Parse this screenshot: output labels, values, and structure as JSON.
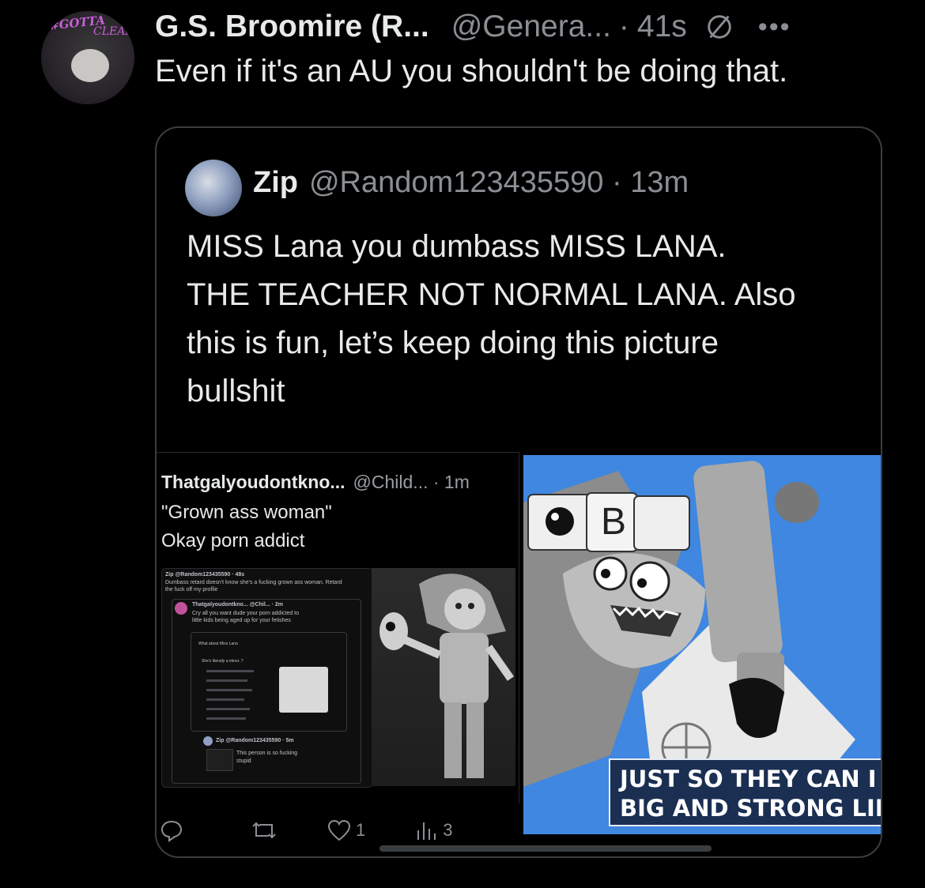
{
  "outer_tweet": {
    "avatar_tag": "#GOTTA",
    "avatar_tag2": "CLEAN",
    "author_name": "G.S. Broomire (R...",
    "handle": "@Genera...",
    "separator": "·",
    "time": "41s",
    "more_label": "•••",
    "text": "Even if it's an AU you shouldn't be doing that."
  },
  "quoted_tweet": {
    "author_name": "Zip",
    "handle": "@Random123435590",
    "separator": "·",
    "time": "13m",
    "lines": [
      "MISS Lana you dumbass MISS LANA.",
      "THE TEACHER NOT NORMAL LANA. Also",
      "this is fun, let’s keep doing this picture",
      "bullshit"
    ],
    "media_left": {
      "author_name": "Thatgalyoudontkno...",
      "handle": "@Child...",
      "time": "· 1m",
      "lines": [
        "\"Grown ass woman\"",
        "Okay porn addict"
      ],
      "nested": {
        "zip_line": "Zip @Random123435590 · 48s",
        "zip_text1": "Dumbass retard doesn't know she's a fucking grown ass woman. Retard",
        "zip_text2": "the fuck off my profile",
        "tg_line": "Thatgalyoudontkno... @Chil... · 2m",
        "tg_text1": "Cry all you want dude your porn addicted to",
        "tg_text2": "little kids being aged up for your fetishes",
        "inner_q": "What about Miss Lana",
        "inner_q2": "She's literally a minor..?",
        "zip2_line": "Zip @Random123435590 · 5m",
        "zip2_text1": "This person is so fucking",
        "zip2_text2": "stupid"
      }
    },
    "media_right": {
      "sign_letter": "B",
      "caption_line1": "JUST SO THEY CAN I",
      "caption_line2": "BIG AND STRONG LIKE"
    },
    "actions": {
      "likes": "1",
      "views": "3"
    }
  }
}
